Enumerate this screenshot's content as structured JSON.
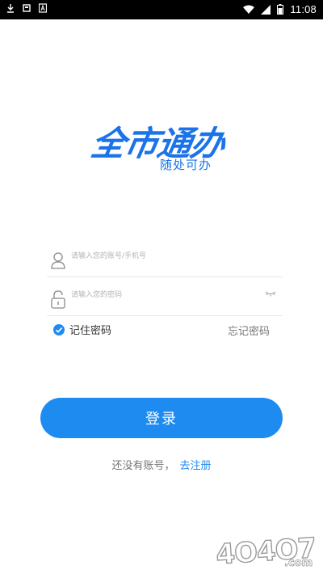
{
  "status_bar": {
    "time": "11:08",
    "left_icons": [
      "download-icon",
      "square-icon",
      "a-icon"
    ],
    "right_icons": [
      "wifi-icon",
      "cell-signal-icon",
      "battery-icon"
    ]
  },
  "logo": {
    "main": "全市通办",
    "tagline": "随处可办",
    "color": "#1a73e8"
  },
  "form": {
    "account": {
      "placeholder": "请输入您的账号/手机号",
      "value": "",
      "icon": "user-icon"
    },
    "password": {
      "placeholder": "请输入您的密码",
      "value": "",
      "icon": "lock-icon",
      "toggle_icon": "eye-closed-icon"
    },
    "remember": {
      "label": "记住密码",
      "checked": true
    },
    "forgot_label": "忘记密码",
    "login_label": "登录",
    "no_account_text": "还没有账号，",
    "register_label": "去注册"
  },
  "colors": {
    "primary": "#1e8bf1",
    "text_secondary": "#777777"
  },
  "watermark": {
    "text": "4O4O7.com"
  }
}
